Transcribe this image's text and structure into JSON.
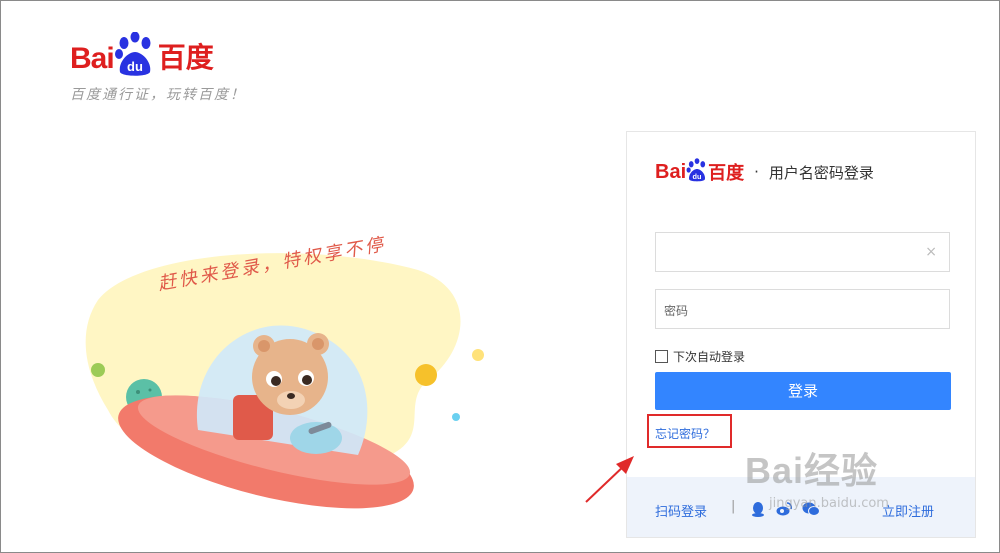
{
  "brand": {
    "bai": "Bai",
    "du": "du",
    "cn": "百度",
    "slogan": "百度通行证，玩转百度！"
  },
  "illustration": {
    "banner": "赶快来登录，特权享不停"
  },
  "login_panel": {
    "title_sep": "·",
    "title": "用户名密码登录",
    "username": {
      "placeholder": "",
      "clear_icon": "×"
    },
    "password": {
      "placeholder": "密码"
    },
    "remember_label": "下次自动登录",
    "login_button": "登录",
    "forgot_link": "忘记密码？",
    "footer": {
      "scan_login": "扫码登录",
      "separator": "|",
      "register": "立即注册"
    }
  },
  "watermark": {
    "line1": "Bai经验",
    "line2": "jingyan.baidu.com"
  },
  "colors": {
    "brand_red": "#de1f1f",
    "brand_blue": "#2932e1",
    "button_blue": "#3385ff",
    "link_blue": "#2e6cdc",
    "highlight_red": "#e02a2a"
  }
}
